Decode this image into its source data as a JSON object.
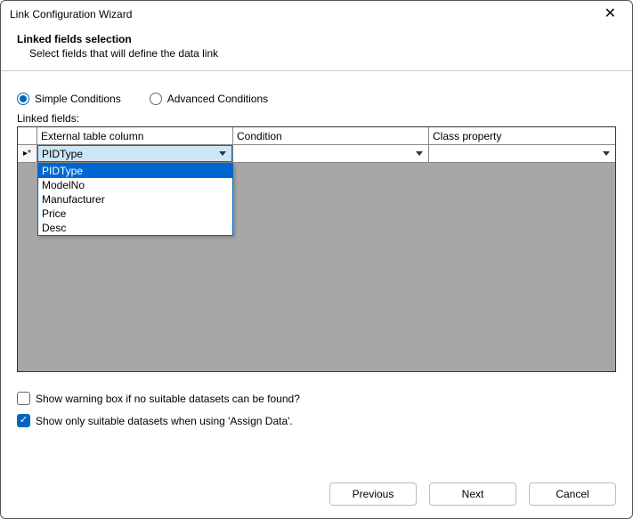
{
  "window": {
    "title": "Link Configuration Wizard"
  },
  "header": {
    "title": "Linked fields selection",
    "subtitle": "Select fields that will define the data link"
  },
  "radios": {
    "simple": {
      "label": "Simple Conditions",
      "checked": true
    },
    "advanced": {
      "label": "Advanced Conditions",
      "checked": false
    }
  },
  "section_label": "Linked fields:",
  "grid": {
    "columns": {
      "col1": "External table column",
      "col2": "Condition",
      "col3": "Class property"
    },
    "row1": {
      "col1_value": "PIDType",
      "col2_value": "",
      "col3_value": ""
    },
    "dropdown": {
      "options": [
        "PIDType",
        "ModelNo",
        "Manufacturer",
        "Price",
        "Desc"
      ],
      "selected": "PIDType"
    }
  },
  "checkboxes": {
    "warning": {
      "label": "Show warning box if no suitable datasets can be found?",
      "checked": false
    },
    "suitable": {
      "label": "Show only suitable datasets when using 'Assign Data'.",
      "checked": true
    }
  },
  "buttons": {
    "previous": "Previous",
    "next": "Next",
    "cancel": "Cancel"
  }
}
